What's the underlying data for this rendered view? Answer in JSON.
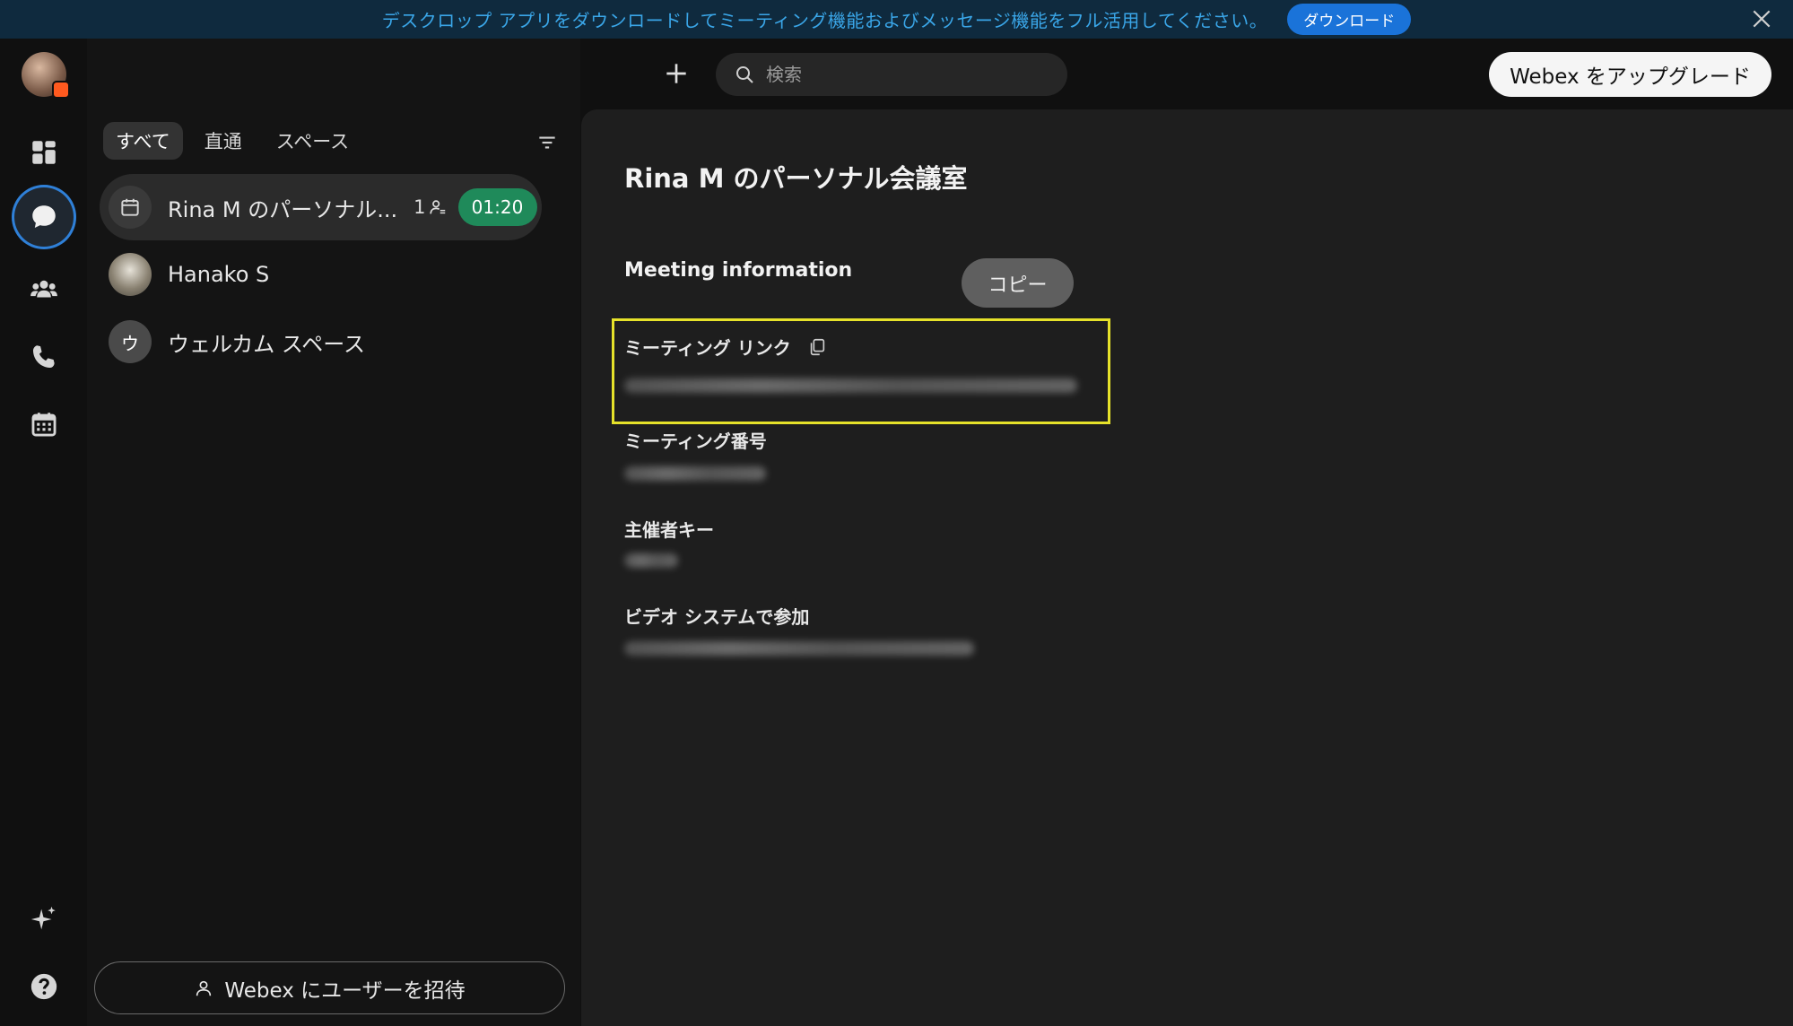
{
  "banner": {
    "text": "デスクロップ アプリをダウンロードしてミーティング機能およびメッセージ機能をフル活用してください。",
    "download_label": "ダウンロード"
  },
  "header": {
    "search_placeholder": "検索",
    "upgrade_label": "Webex をアップグレード"
  },
  "filters": {
    "all": "すべて",
    "direct": "直通",
    "spaces": "スペース"
  },
  "list": {
    "items": [
      {
        "name": "Rina M のパーソナル...",
        "count": "1",
        "timer": "01:20"
      },
      {
        "name": "Hanako S"
      },
      {
        "name": "ウェルカム スペース",
        "initial": "ウ"
      }
    ]
  },
  "invite_label": "Webex にユーザーを招待",
  "content": {
    "title": "Rina M のパーソナル会議室",
    "section_title": "Meeting information",
    "copy_label": "コピー",
    "fields": {
      "link_label": "ミーティング リンク",
      "number_label": "ミーティング番号",
      "host_key_label": "主催者キー",
      "video_label": "ビデオ システムで参加"
    }
  },
  "colors": {
    "accent": "#2f80d8",
    "timer_green": "#1f8a5a",
    "highlight": "#e6e22a",
    "banner_bg": "#0f2a3e"
  }
}
